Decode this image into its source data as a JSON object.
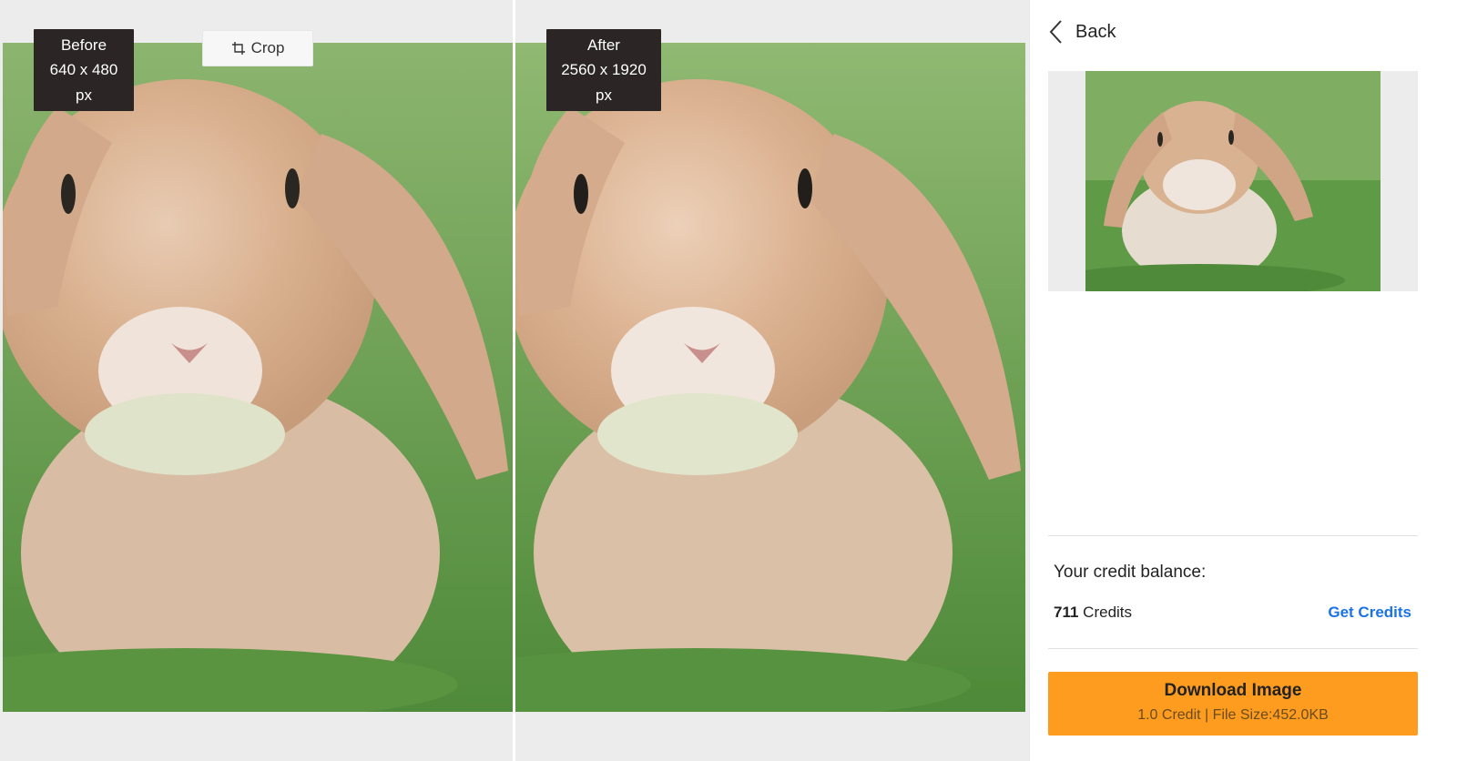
{
  "compare": {
    "before": {
      "label": "Before",
      "size": "640 x 480 px"
    },
    "after": {
      "label": "After",
      "size": "2560 x 1920 px"
    },
    "crop_label": "Crop"
  },
  "sidebar": {
    "back_label": "Back",
    "credit_title": "Your credit balance:",
    "credit_amount": "711",
    "credit_unit": "Credits",
    "get_credits_label": "Get Credits",
    "download_label": "Download Image",
    "download_info": "1.0 Credit | File Size:452.0KB"
  },
  "colors": {
    "accent": "#fd9c1f",
    "link": "#1a73e8",
    "label_bg": "#2b2625"
  },
  "icons": {
    "crop": "crop-icon",
    "back": "chevron-left-icon"
  }
}
